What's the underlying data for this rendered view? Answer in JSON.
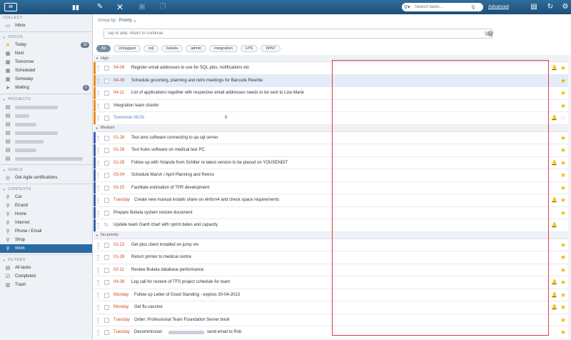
{
  "topbar": {
    "logo": "m",
    "search_placeholder": "Search tasks...",
    "advanced_label": "Advanced",
    "icons": [
      "pencil-icon",
      "close-icon",
      "move-icon",
      "copy-icon",
      "chat-icon",
      "refresh-icon",
      "gear-icon"
    ]
  },
  "sidebar": {
    "collect": {
      "header": "COLLECT",
      "items": [
        {
          "label": "Inbox",
          "icon": "inbox-icon"
        }
      ]
    },
    "focus": {
      "header": "FOCUS",
      "items": [
        {
          "label": "Today",
          "icon": "star-icon",
          "count": "36"
        },
        {
          "label": "Next",
          "icon": "next-icon"
        },
        {
          "label": "Tomorrow",
          "icon": "calendar-icon"
        },
        {
          "label": "Scheduled",
          "icon": "calendar-icon"
        },
        {
          "label": "Someday",
          "icon": "calendar-icon"
        },
        {
          "label": "Waiting",
          "icon": "send-icon",
          "count": "6"
        }
      ]
    },
    "projects": {
      "header": "PROJECTS",
      "redacted_count": 7
    },
    "goals": {
      "header": "GOALS",
      "items": [
        {
          "label": "Get Agile certifications",
          "icon": "target-icon"
        }
      ]
    },
    "contexts": {
      "header": "CONTEXTS",
      "items": [
        {
          "label": "Car"
        },
        {
          "label": "Errand"
        },
        {
          "label": "Home"
        },
        {
          "label": "Internet"
        },
        {
          "label": "Phone / Email"
        },
        {
          "label": "Shop"
        },
        {
          "label": "Work",
          "active": true
        }
      ]
    },
    "filters": {
      "header": "FILTERS",
      "items": [
        {
          "label": "All tasks",
          "icon": "list-icon"
        },
        {
          "label": "Completed",
          "icon": "check-icon"
        },
        {
          "label": "Trash",
          "icon": "trash-icon"
        }
      ]
    }
  },
  "main": {
    "groupby_label": "Group by:",
    "groupby_value": "Priority",
    "add_placeholder": "Tap to add, return to continue.",
    "help": "?",
    "tags": [
      "All",
      "Untagged",
      "sql",
      "bukela",
      "admin",
      "integration",
      "LPS",
      "WIN7"
    ],
    "groups": [
      {
        "name": "High",
        "color": "#f08c1a",
        "tasks": [
          {
            "due": "04-08",
            "title": "Register email addresses to use for SQL jobs, notifications etc",
            "bell": true,
            "star": true
          },
          {
            "due": "04-09",
            "title": "Schedule grooming, planning and retro meetings for Barcode Rewrite",
            "star": true,
            "selected": true
          },
          {
            "due": "04-11",
            "title": "List of applications together with respective email addresses needs to be sent to Lize-Marie",
            "star": true
          },
          {
            "due": "",
            "title": "Integration team charter",
            "star": true
          },
          {
            "due": "Tomorrow 08:00",
            "due_blue": true,
            "title": "0",
            "bell": true,
            "star": false
          }
        ]
      },
      {
        "name": "Medium",
        "color": "#3b5fad",
        "tasks": [
          {
            "due": "01-28",
            "title": "Test ams software connecting to qa sql server",
            "star": true
          },
          {
            "due": "01-28",
            "title": "Test Koko software on medical test PC",
            "star": true
          },
          {
            "due": "01-28",
            "title": "Follow up with Yolande from Schiller re latest version to be placed on YOUSENDIT",
            "bell": true,
            "star": true
          },
          {
            "due": "03-04",
            "title": "Schedule March / April Planning and Retros",
            "star": true
          },
          {
            "due": "03-15",
            "title": "Facilitate estimation of TPR development",
            "star": true
          },
          {
            "due": "Tuesday",
            "title": "Create new manual installs share on elnfsrv4 and check space requirements",
            "bell": true,
            "star": true
          },
          {
            "due": "",
            "title": "Prepare Bukela system restore document",
            "star": true
          },
          {
            "due": "",
            "title": "Update team Gantt chart with sprint dates and capacity",
            "spin": true,
            "bell": true,
            "star": false,
            "no_star": true
          }
        ]
      },
      {
        "name": "No priority",
        "color": "#ffffff",
        "tasks": [
          {
            "due": "01-23",
            "title": "Get plus client installed on jump vm",
            "star": true
          },
          {
            "due": "01-28",
            "title": "Return printer to medical centre",
            "star": true
          },
          {
            "due": "02-11",
            "title": "Review Bukela database performance",
            "star": true
          },
          {
            "due": "04-08",
            "title": "Log call for restore of TFS project schedule for team",
            "bell": true,
            "star": true
          },
          {
            "due": "Monday",
            "title": "Follow up Letter of Good Standing - expires 30-04-2013",
            "bell": true,
            "star": true
          },
          {
            "due": "Monday",
            "title": "Get flu vaccine",
            "bell": true,
            "star": true
          },
          {
            "due": "Tuesday",
            "title": "Order: Professional Team Foundation Server book",
            "star": true
          },
          {
            "due": "Tuesday",
            "title": "Decommission",
            "title2": "send email to Rob",
            "star": true
          }
        ]
      }
    ]
  }
}
